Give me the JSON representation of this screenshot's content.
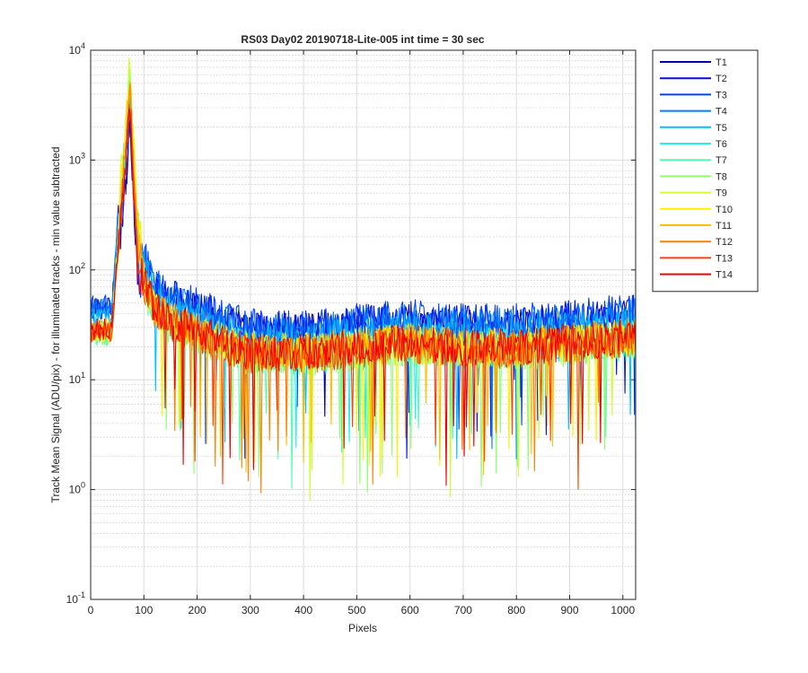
{
  "chart_data": {
    "type": "line",
    "title": "RS03 Day02 20190718-Lite-005 int time = 30 sec",
    "xlabel": "Pixels",
    "ylabel": "Track Mean Signal (ADU/pix) - for illuminated tracks - min value subtracted",
    "xlim": [
      0,
      1024
    ],
    "ylim": [
      0.1,
      10000
    ],
    "yscale": "log",
    "x_ticks": [
      0,
      100,
      200,
      300,
      400,
      500,
      600,
      700,
      800,
      900,
      1000
    ],
    "y_ticks": [
      {
        "base": "10",
        "exp": "-1",
        "value": 0.1
      },
      {
        "base": "10",
        "exp": "0",
        "value": 1
      },
      {
        "base": "10",
        "exp": "1",
        "value": 10
      },
      {
        "base": "10",
        "exp": "2",
        "value": 100
      },
      {
        "base": "10",
        "exp": "3",
        "value": 1000
      },
      {
        "base": "10",
        "exp": "4",
        "value": 10000
      }
    ],
    "grid": true,
    "legend_position": "outside-right",
    "profile": {
      "x": [
        0,
        20,
        40,
        50,
        60,
        66,
        70,
        73,
        76,
        80,
        85,
        90,
        100,
        120,
        150,
        200,
        250,
        300,
        400,
        500,
        600,
        700,
        800,
        900,
        1024
      ],
      "y": [
        40,
        40,
        40,
        200,
        600,
        1200,
        2600,
        4500,
        2600,
        1000,
        300,
        150,
        80,
        45,
        35,
        28,
        22,
        18,
        18,
        20,
        22,
        20,
        20,
        22,
        25
      ]
    },
    "series": [
      {
        "name": "T1",
        "color": "#0000b8",
        "peak": 2300,
        "base": 30,
        "seed": 1
      },
      {
        "name": "T2",
        "color": "#0010e0",
        "peak": 2600,
        "base": 32,
        "seed": 2
      },
      {
        "name": "T3",
        "color": "#0040ff",
        "peak": 3200,
        "base": 33,
        "seed": 3
      },
      {
        "name": "T4",
        "color": "#0080ff",
        "peak": 3800,
        "base": 30,
        "seed": 4
      },
      {
        "name": "T5",
        "color": "#00c0ff",
        "peak": 4500,
        "base": 25,
        "seed": 5
      },
      {
        "name": "T6",
        "color": "#20f0f0",
        "peak": 5200,
        "base": 20,
        "seed": 6
      },
      {
        "name": "T7",
        "color": "#50ffb0",
        "peak": 6000,
        "base": 18,
        "seed": 7
      },
      {
        "name": "T8",
        "color": "#90ff70",
        "peak": 6800,
        "base": 18,
        "seed": 8
      },
      {
        "name": "T9",
        "color": "#d0ff30",
        "peak": 7200,
        "base": 19,
        "seed": 9
      },
      {
        "name": "T10",
        "color": "#fff000",
        "peak": 7000,
        "base": 20,
        "seed": 10
      },
      {
        "name": "T11",
        "color": "#ffc000",
        "peak": 6000,
        "base": 20,
        "seed": 11
      },
      {
        "name": "T12",
        "color": "#ff8000",
        "peak": 4500,
        "base": 19,
        "seed": 12
      },
      {
        "name": "T13",
        "color": "#ff4000",
        "peak": 3500,
        "base": 19,
        "seed": 13
      },
      {
        "name": "T14",
        "color": "#f00000",
        "peak": 2800,
        "base": 20,
        "seed": 14
      }
    ]
  }
}
